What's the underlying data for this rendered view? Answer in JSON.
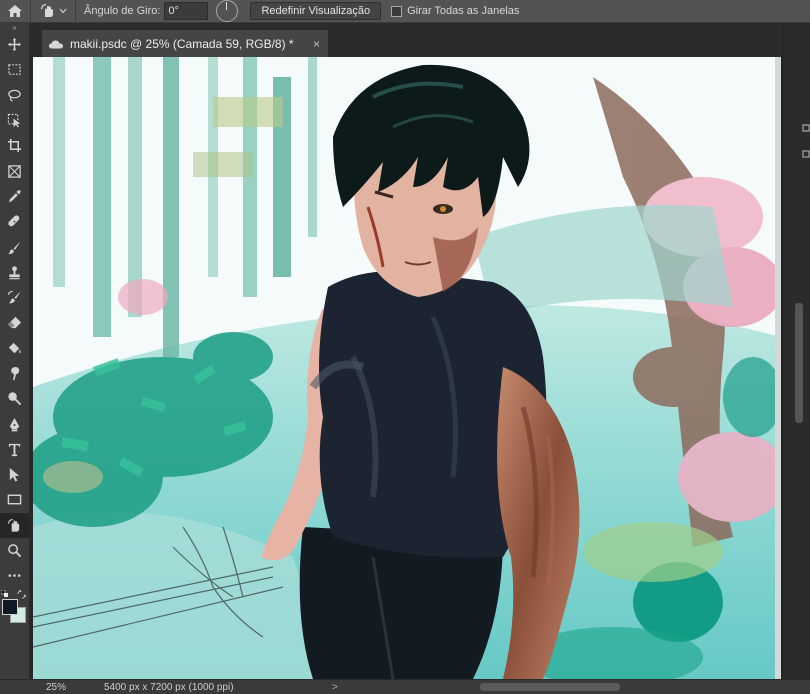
{
  "options_bar": {
    "rotate_angle_label": "Ângulo de Giro:",
    "rotate_angle_value": "0°",
    "reset_view_label": "Redefinir Visualização",
    "rotate_all_windows_label": "Girar Todas as Janelas",
    "rotate_all_windows_checked": false
  },
  "document_tab": {
    "title": "makii.psdc @ 25% (Camada 59, RGB/8) *",
    "close": "×"
  },
  "toolbar": {
    "collapse_indicator": "»",
    "tools": [
      "move-icon",
      "marquee-icon",
      "lasso-icon",
      "object-select-icon",
      "crop-icon",
      "frame-icon",
      "eyedropper-icon",
      "healing-brush-icon",
      "brush-icon",
      "clone-stamp-icon",
      "history-brush-icon",
      "eraser-icon",
      "paint-bucket-icon",
      "smudge-icon",
      "dodge-icon",
      "pen-icon",
      "type-icon",
      "path-select-icon",
      "rectangle-icon",
      "rotate-view-icon",
      "zoom-icon",
      "more-tools-icon"
    ],
    "active_tool": "rotate-view-icon",
    "foreground_color": "#0f1a24",
    "background_color": "#d6ebdf"
  },
  "status_bar": {
    "zoom": "25%",
    "document_info": "5400 px x 7200 px (1000 ppi)",
    "arrow": ">"
  }
}
